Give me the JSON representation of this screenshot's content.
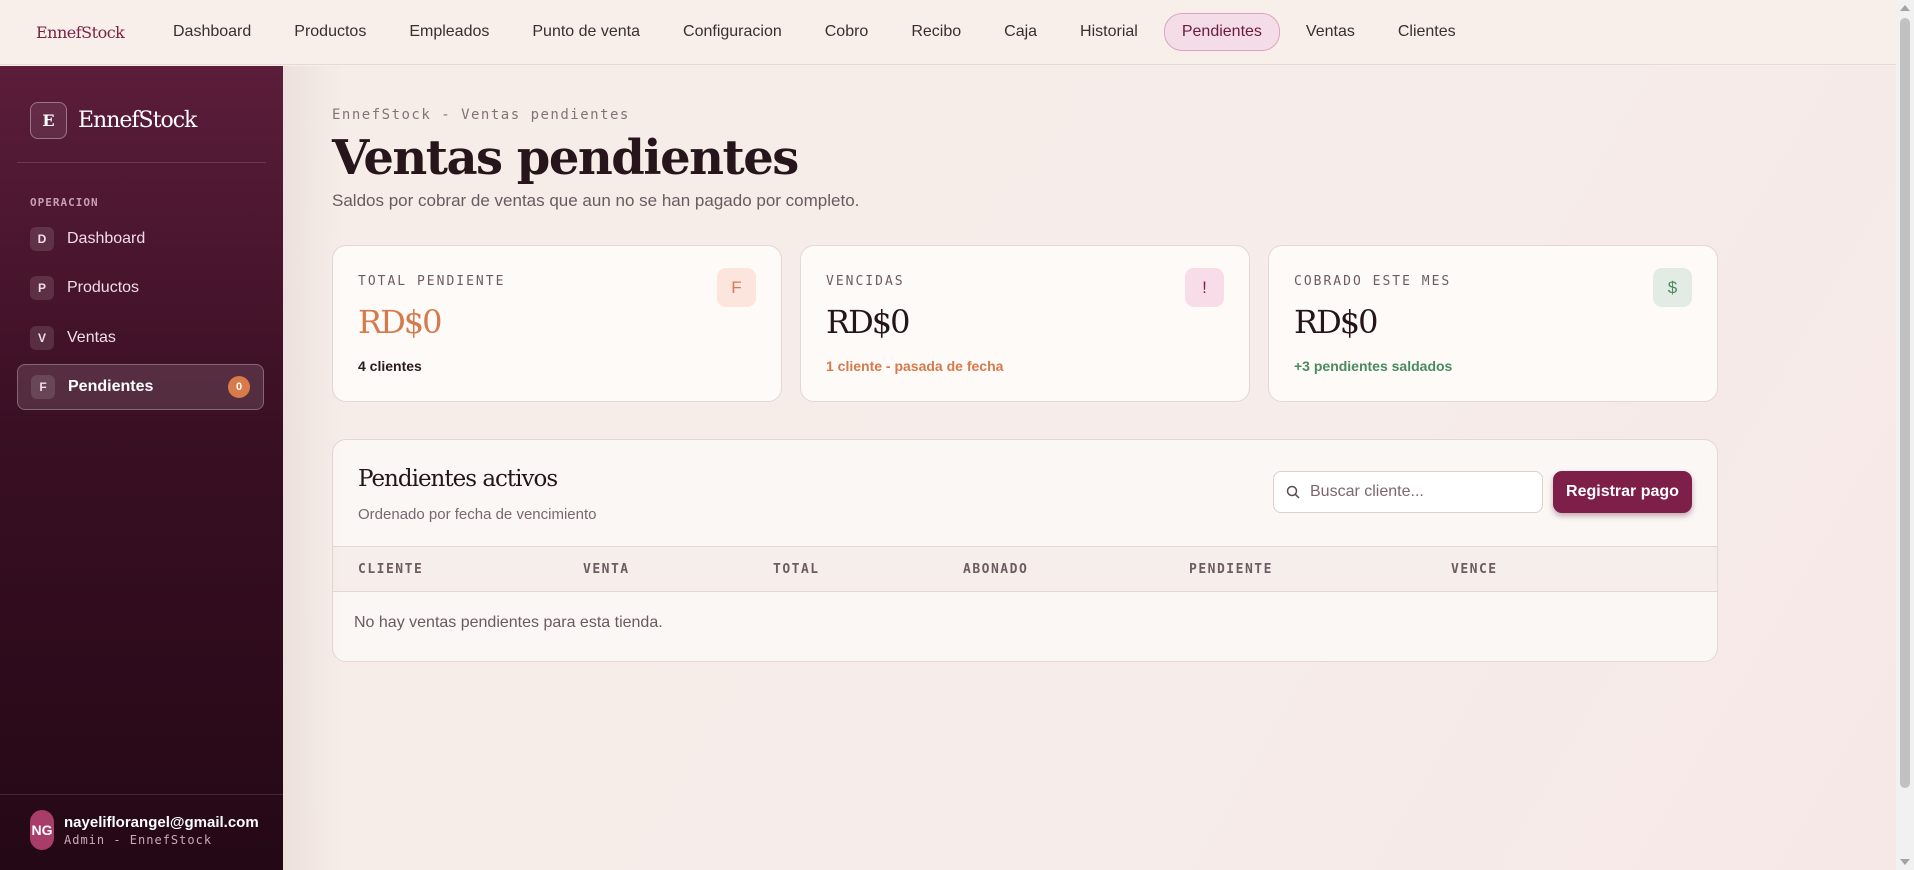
{
  "topnav": {
    "brand": "EnnefStock",
    "links": [
      "Dashboard",
      "Productos",
      "Empleados",
      "Punto de venta",
      "Configuracion",
      "Cobro",
      "Recibo",
      "Caja",
      "Historial",
      "Pendientes",
      "Ventas",
      "Clientes"
    ],
    "active": "Pendientes"
  },
  "sidebar": {
    "logo_letter": "E",
    "brand": "EnnefStock",
    "section": "OPERACION",
    "items": [
      {
        "letter": "D",
        "label": "Dashboard"
      },
      {
        "letter": "P",
        "label": "Productos"
      },
      {
        "letter": "V",
        "label": "Ventas"
      },
      {
        "letter": "F",
        "label": "Pendientes",
        "badge": "0",
        "active": true
      }
    ],
    "user": {
      "initials": "NG",
      "email": "nayeliflorangel@gmail.com",
      "role": "Admin - EnnefStock"
    }
  },
  "page": {
    "eyebrow": "EnnefStock - Ventas pendientes",
    "title": "Ventas pendientes",
    "subtitle": "Saldos por cobrar de ventas que aun no se han pagado por completo."
  },
  "cards": [
    {
      "label": "TOTAL PENDIENTE",
      "value": "RD$0",
      "note": "4 clientes",
      "icon": "F",
      "note_color": "#2a1a1f",
      "icon_bg": "#fbe5dc",
      "icon_color": "#d57a4c",
      "value_color": "#d57a4c"
    },
    {
      "label": "VENCIDAS",
      "value": "RD$0",
      "note": "1 cliente - pasada de fecha",
      "icon": "!",
      "note_color": "#d57a4c",
      "icon_bg": "#f8dde8",
      "icon_color": "#7d1f48",
      "value_color": "#24151a"
    },
    {
      "label": "COBRADO ESTE MES",
      "value": "RD$0",
      "note": "+3 pendientes saldados",
      "icon": "$",
      "note_color": "#4a8a5e",
      "icon_bg": "#e2ece4",
      "icon_color": "#4a8a5e",
      "value_color": "#24151a"
    }
  ],
  "panel": {
    "title": "Pendientes activos",
    "subtitle": "Ordenado por fecha de vencimiento",
    "search_placeholder": "Buscar cliente...",
    "button": "Registrar pago",
    "columns": [
      "CLIENTE",
      "VENTA",
      "TOTAL",
      "ABONADO",
      "PENDIENTE",
      "VENCE"
    ],
    "empty": "No hay ventas pendientes para esta tienda."
  }
}
